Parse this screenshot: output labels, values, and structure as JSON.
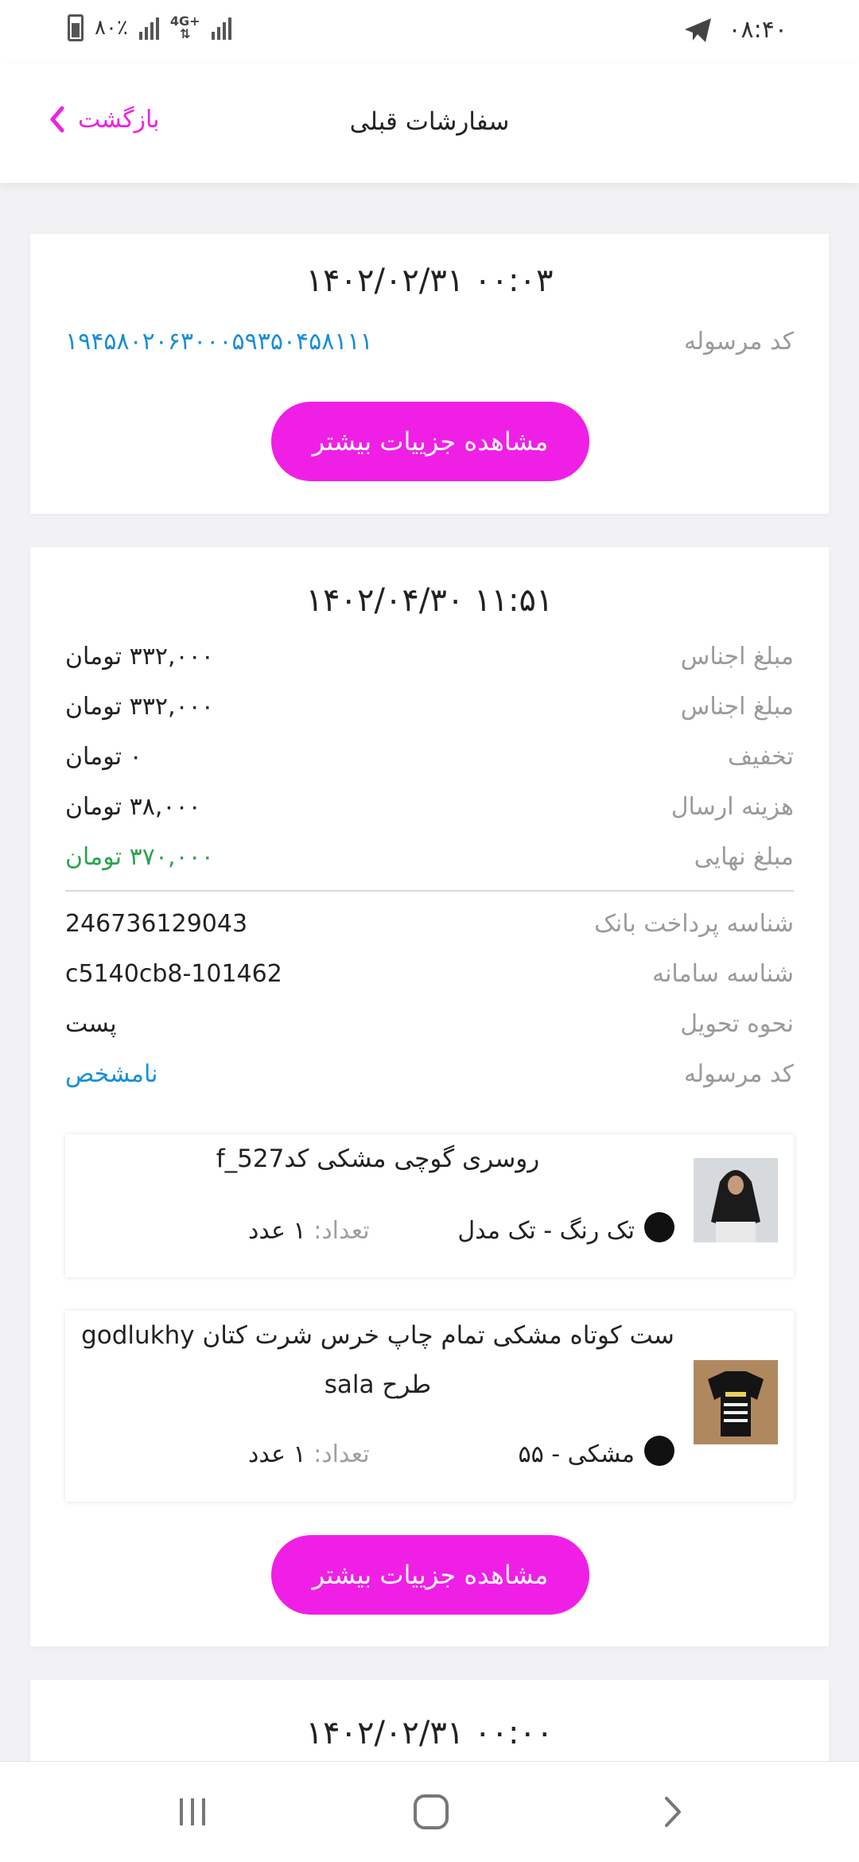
{
  "status_bar": {
    "time": "۰۸:۴۰",
    "battery": "۸۰٪",
    "network": "4G+"
  },
  "header": {
    "title": "سفارشات قبلی",
    "back_label": "بازگشت"
  },
  "orders": [
    {
      "date": "۱۴۰۲/۰۲/۳۱ ۰۰:۰۳",
      "tracking_label": "کد مرسوله",
      "tracking_value": "۱۹۴۵۸۰۲۰۶۳۰۰۰۵۹۳۵۰۴۵۸۱۱۱",
      "details_button": "مشاهده جزییات بیشتر"
    },
    {
      "date": "۱۴۰۲/۰۴/۳۰ ۱۱:۵۱",
      "rows": [
        {
          "label": "مبلغ اجناس",
          "value": "۳۳۲,۰۰۰ تومان"
        },
        {
          "label": "مبلغ اجناس",
          "value": "۳۳۲,۰۰۰ تومان"
        },
        {
          "label": "تخفیف",
          "value": "۰ تومان"
        },
        {
          "label": "هزینه ارسال",
          "value": "۳۸,۰۰۰ تومان"
        },
        {
          "label": "مبلغ نهایی",
          "value": "۳۷۰,۰۰۰ تومان"
        }
      ],
      "info_rows": [
        {
          "label": "شناسه پرداخت بانک",
          "value": "246736129043"
        },
        {
          "label": "شناسه سامانه",
          "value": "c5140cb8-101462"
        },
        {
          "label": "نحوه تحویل",
          "value": "پست"
        },
        {
          "label": "کد مرسوله",
          "value": "نامشخص"
        }
      ],
      "items": [
        {
          "name": "روسری گوچی مشکی کدf_527",
          "variant": "تک رنگ  -  تک مدل",
          "qty_label": "تعداد:",
          "qty_value": "۱ عدد"
        },
        {
          "name": "ست کوتاه مشکی تمام چاپ خرس شرت کتان godlukhy طرح sala",
          "variant": "مشکی  -  ۵۵",
          "qty_label": "تعداد:",
          "qty_value": "۱ عدد"
        }
      ],
      "details_button": "مشاهده جزییات بیشتر"
    },
    {
      "date": "۱۴۰۲/۰۲/۳۱ ۰۰:۰۰"
    }
  ],
  "colors": {
    "accent": "#f01fe6",
    "link_blue": "#1a8fd6",
    "total_green": "#2da44e"
  }
}
